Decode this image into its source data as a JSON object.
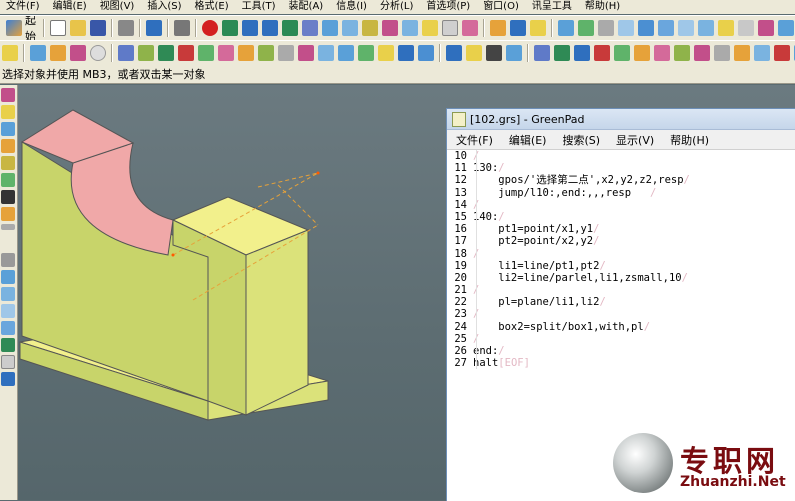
{
  "menubar": {
    "items": [
      "文件(F)",
      "编辑(E)",
      "视图(V)",
      "插入(S)",
      "格式(E)",
      "工具(T)",
      "装配(A)",
      "信息(I)",
      "分析(L)",
      "首选项(P)",
      "窗口(O)",
      "讯呈工具",
      "帮助(H)"
    ]
  },
  "toolbar": {
    "start_label": "起始"
  },
  "status": {
    "prompt": "选择对象并使用 MB3，或者双击某一对象"
  },
  "greenpad": {
    "title": "[102.grs] - GreenPad",
    "menu": [
      "文件(F)",
      "编辑(E)",
      "搜索(S)",
      "显示(V)",
      "帮助(H)"
    ],
    "lines": [
      {
        "n": "10",
        "text": "",
        "mark": "/"
      },
      {
        "n": "11",
        "text": "130:",
        "mark": "/"
      },
      {
        "n": "12",
        "text": "    gpos/'选择第二点',x2,y2,z2,resp",
        "mark": "/"
      },
      {
        "n": "13",
        "text": "    jump/l10:,end:,,,resp   ",
        "mark": "/"
      },
      {
        "n": "14",
        "text": "",
        "mark": "/"
      },
      {
        "n": "15",
        "text": "140:",
        "mark": "/"
      },
      {
        "n": "16",
        "text": "    pt1=point/x1,y1",
        "mark": "/"
      },
      {
        "n": "17",
        "text": "    pt2=point/x2,y2",
        "mark": "/"
      },
      {
        "n": "18",
        "text": "",
        "mark": "/"
      },
      {
        "n": "19",
        "text": "    li1=line/pt1,pt2",
        "mark": "/"
      },
      {
        "n": "20",
        "text": "    li2=line/parlel,li1,zsmall,10",
        "mark": "/"
      },
      {
        "n": "21",
        "text": "",
        "mark": "/"
      },
      {
        "n": "22",
        "text": "    pl=plane/li1,li2",
        "mark": "/"
      },
      {
        "n": "23",
        "text": "",
        "mark": "/"
      },
      {
        "n": "24",
        "text": "    box2=split/box1,with,pl",
        "mark": "/"
      },
      {
        "n": "25",
        "text": "",
        "mark": "/"
      },
      {
        "n": "26",
        "text": "end:",
        "mark": "/"
      },
      {
        "n": "27",
        "text": "halt",
        "mark": "[EOF]"
      }
    ]
  },
  "watermark": {
    "cn": "专职网",
    "en": "Zhuanzhi.Net"
  },
  "colors": {
    "part_side": "#c8d46a",
    "part_top": "#f2f08c",
    "arc": "#f0a8a8",
    "accent": "#7a0c10"
  }
}
